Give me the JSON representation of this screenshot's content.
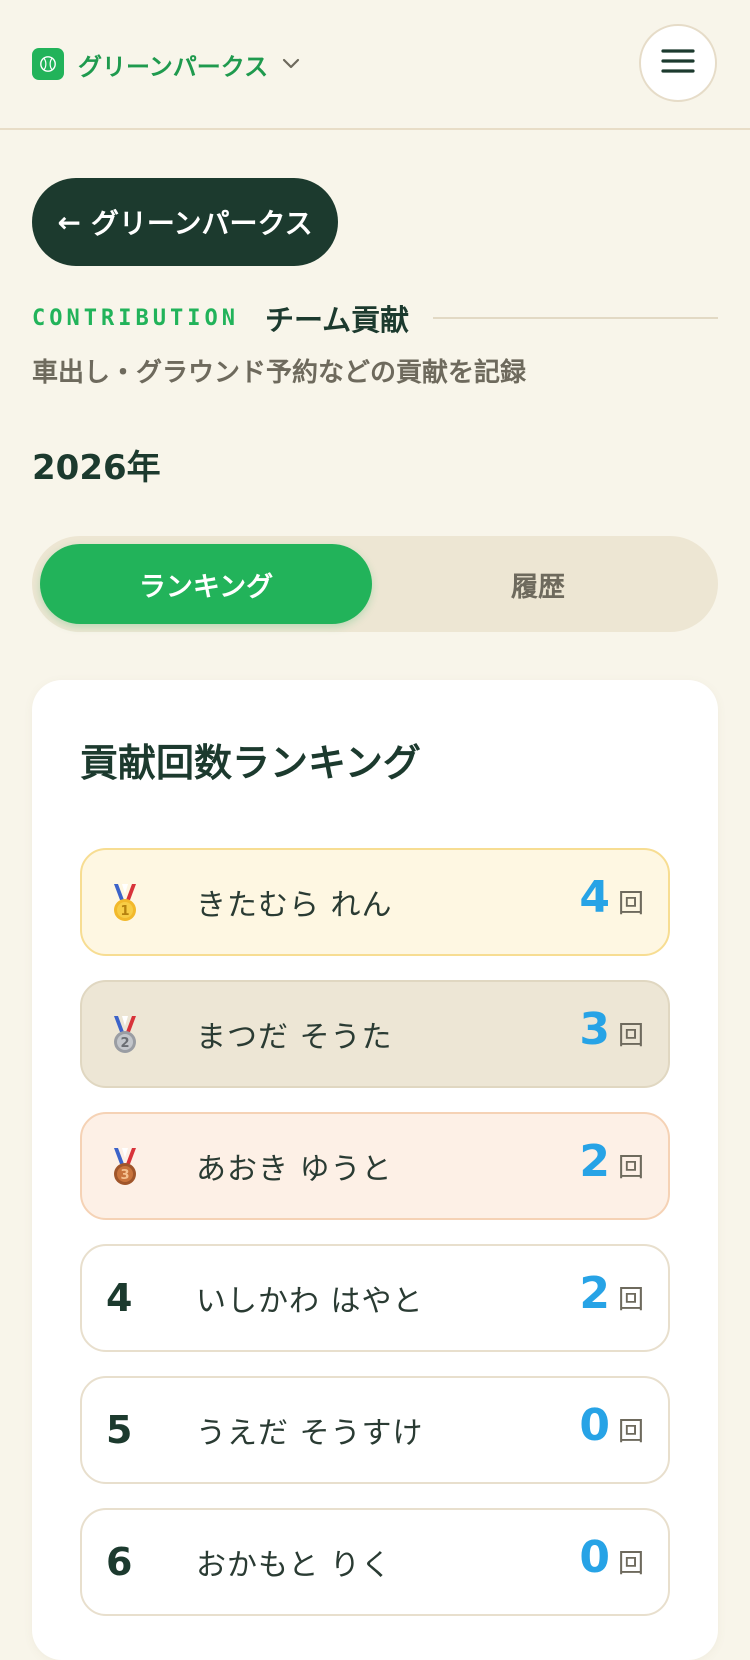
{
  "header": {
    "team_name": "グリーンパークス",
    "logo_icon": "baseball-icon",
    "dropdown_icon": "chevron-down-icon",
    "menu_icon": "hamburger-menu-icon"
  },
  "back_button": {
    "arrow": "←",
    "label": "グリーンパークス"
  },
  "section": {
    "eyebrow": "CONTRIBUTION",
    "title": "チーム貢献",
    "subtitle": "車出し・グラウンド予約などの貢献を記録"
  },
  "year": "2026年",
  "tabs": [
    {
      "label": "ランキング",
      "active": true
    },
    {
      "label": "履歴",
      "active": false
    }
  ],
  "ranking": {
    "title": "貢献回数ランキング",
    "unit": "回",
    "rows": [
      {
        "rank": "1",
        "medal": "gold-medal-icon",
        "name": "きたむら れん",
        "count": "4"
      },
      {
        "rank": "2",
        "medal": "silver-medal-icon",
        "name": "まつだ そうた",
        "count": "3"
      },
      {
        "rank": "3",
        "medal": "bronze-medal-icon",
        "name": "あおき ゆうと",
        "count": "2"
      },
      {
        "rank": "4",
        "medal": "",
        "name": "いしかわ はやと",
        "count": "2"
      },
      {
        "rank": "5",
        "medal": "",
        "name": "うえだ そうすけ",
        "count": "0"
      },
      {
        "rank": "6",
        "medal": "",
        "name": "おかもと りく",
        "count": "0"
      }
    ]
  },
  "colors": {
    "accent_green": "#22b35a",
    "dark_green": "#1c3a2e",
    "score_blue": "#27a3e6",
    "background": "#f8f5ea",
    "gold_row": "#fef7e2",
    "silver_row": "#ede6d5",
    "bronze_row": "#fdf0e6"
  }
}
